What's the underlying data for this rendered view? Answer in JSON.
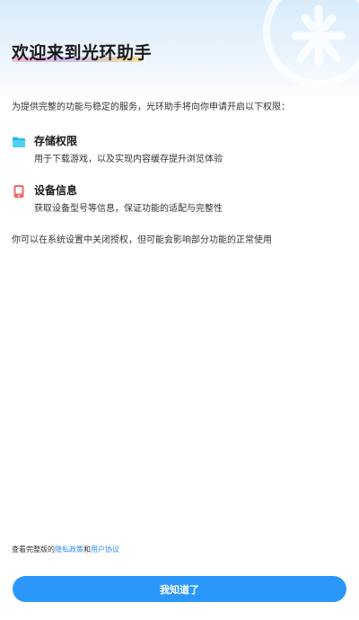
{
  "header": {
    "title": "欢迎来到光环助手"
  },
  "intro": "为提供完整的功能与稳定的服务，光环助手将向你申请开启以下权限：",
  "permissions": [
    {
      "icon": "folder-icon",
      "icon_color": "#23b8e6",
      "title": "存储权限",
      "description": "用于下载游戏，以及实现内容缓存提升浏览体验"
    },
    {
      "icon": "device-icon",
      "icon_color": "#f06a6a",
      "title": "设备信息",
      "description": "获取设备型号等信息，保证功能的适配与完整性"
    }
  ],
  "note": "你可以在系统设置中关闭授权，但可能会影响部分功能的正常使用",
  "footer": {
    "prefix": "查看完整版的",
    "privacy_link": "隐私政策",
    "joiner": "和",
    "terms_link": "用户协议"
  },
  "button": {
    "label": "我知道了"
  },
  "colors": {
    "accent": "#2b97fb",
    "link": "#2f8bf0"
  }
}
